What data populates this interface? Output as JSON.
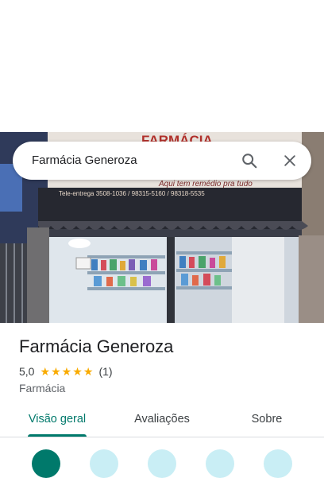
{
  "search": {
    "query": "Farmácia Generoza",
    "search_icon": "search-icon",
    "close_icon": "close-icon"
  },
  "photo": {
    "sign_title": "FARMÁCIA",
    "sign_slogan": "Aqui tem remédio pra tudo",
    "sign_phone": "Tele-entrega  3508-1036 / 98315-5160 / 98318-5535"
  },
  "place": {
    "title": "Farmácia Generoza",
    "rating": "5,0",
    "stars": 5,
    "reviews": "(1)",
    "category": "Farmácia"
  },
  "tabs": [
    {
      "label": "Visão geral",
      "active": true
    },
    {
      "label": "Avaliações",
      "active": false
    },
    {
      "label": "Sobre",
      "active": false
    }
  ],
  "colors": {
    "accent": "#00796b",
    "star": "#f9ab00",
    "action_light": "#c9eef5"
  }
}
